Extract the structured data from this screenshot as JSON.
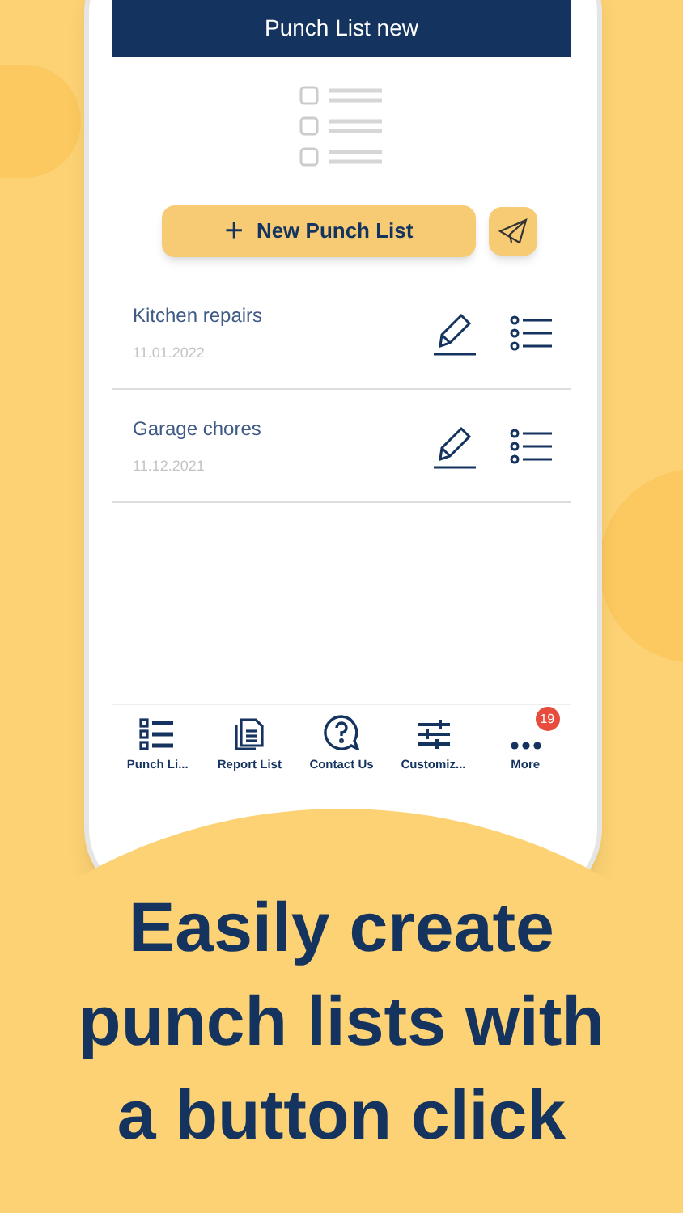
{
  "header": {
    "title": "Punch List new"
  },
  "new_button": {
    "label": "New Punch List",
    "icon": "+"
  },
  "lists": [
    {
      "name": "Kitchen repairs",
      "date": "11.01.2022"
    },
    {
      "name": "Garage chores",
      "date": "11.12.2021"
    }
  ],
  "tab_bar": [
    {
      "label": "Punch Li...",
      "kind": "list"
    },
    {
      "label": "Report List",
      "kind": "report"
    },
    {
      "label": "Contact Us",
      "kind": "help"
    },
    {
      "label": "Customiz...",
      "kind": "sliders"
    },
    {
      "label": "More",
      "kind": "more",
      "badge": "19"
    }
  ],
  "headline": "Easily create punch lists with a button click"
}
